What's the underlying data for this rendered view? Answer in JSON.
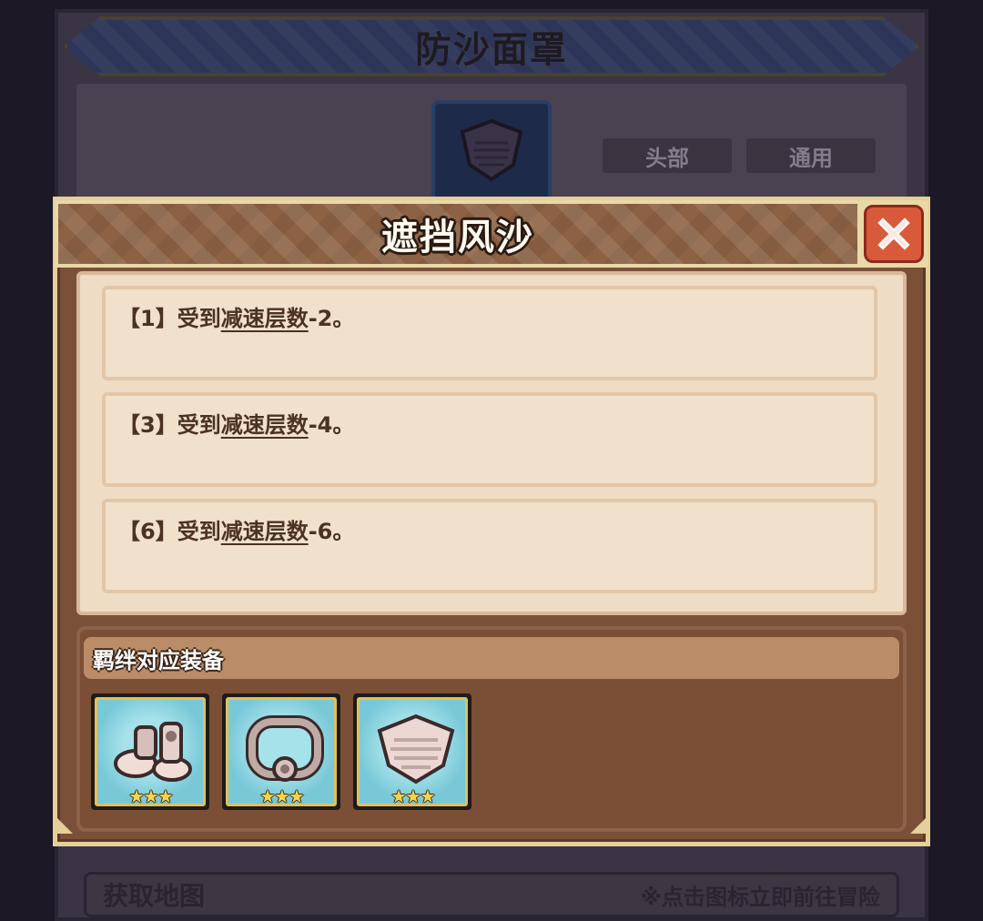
{
  "background": {
    "item_title": "防沙面罩",
    "tags": [
      "头部",
      "通用"
    ],
    "footer_left": "获取地图",
    "footer_right": "※点击图标立即前往冒险"
  },
  "popup": {
    "title": "遮挡风沙",
    "close_icon": "close-x-icon",
    "effects": [
      {
        "prefix": "【1】受到",
        "keyword": "减速层数",
        "suffix": "-2。"
      },
      {
        "prefix": "【3】受到",
        "keyword": "减速层数",
        "suffix": "-4。"
      },
      {
        "prefix": "【6】受到",
        "keyword": "减速层数",
        "suffix": "-6。"
      }
    ],
    "set_header": "羁绊对应装备",
    "set_items": [
      {
        "icon": "boots-icon",
        "stars": "★★★"
      },
      {
        "icon": "ring-icon",
        "stars": "★★★"
      },
      {
        "icon": "mask-icon",
        "stars": "★★★"
      }
    ]
  },
  "colors": {
    "popup_frame": "#7a5038",
    "popup_border": "#e5cf9a",
    "close_red": "#d95a3a",
    "item_card_blue": "#79c8d8",
    "star_yellow": "#f5d64a"
  }
}
